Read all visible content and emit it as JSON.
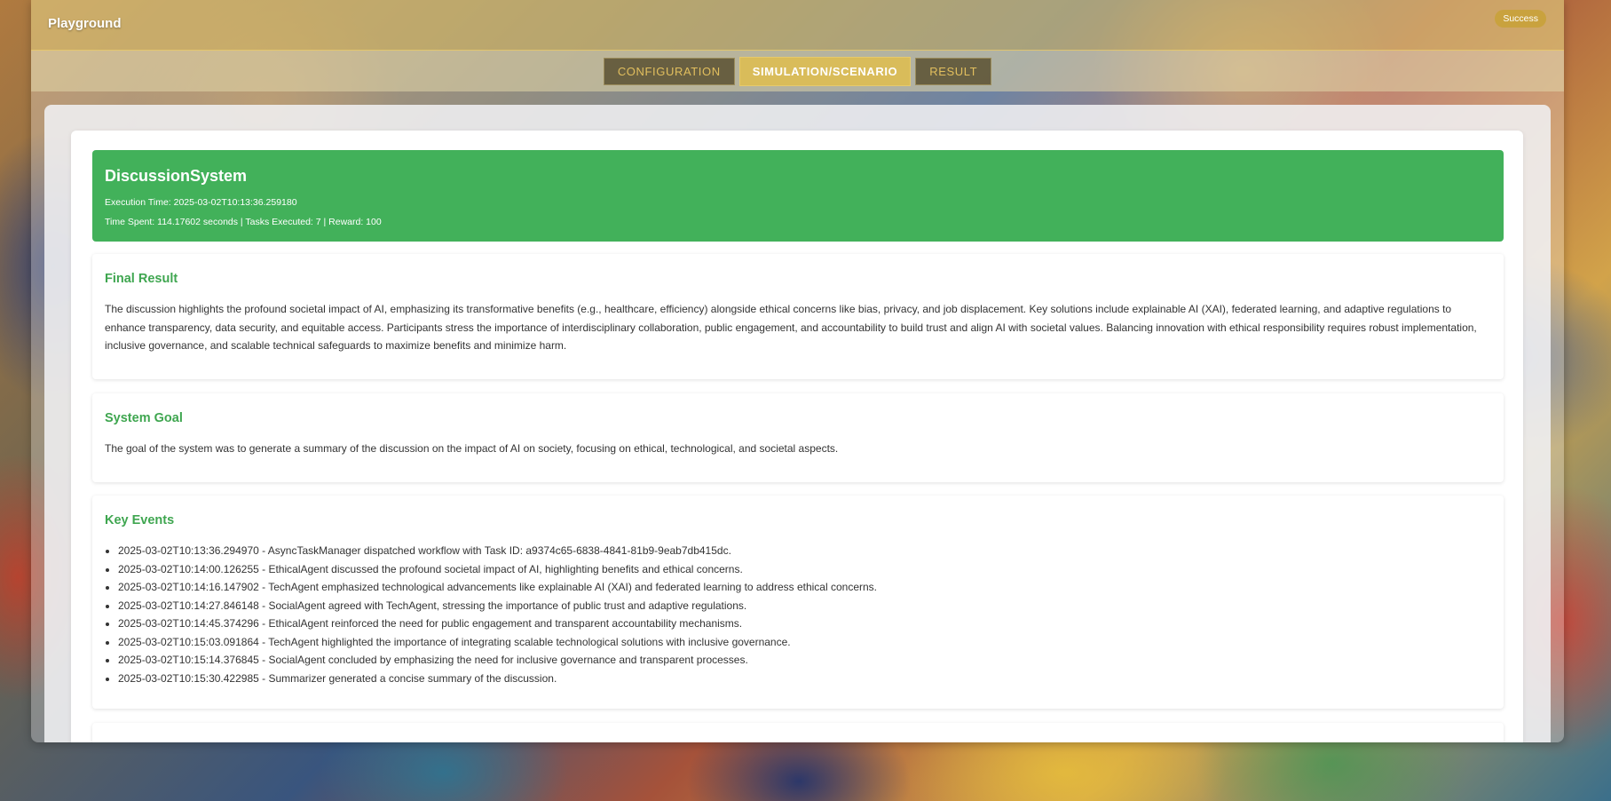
{
  "header": {
    "title": "Playground",
    "status": "Success"
  },
  "tabs": [
    {
      "label": "CONFIGURATION",
      "active": false
    },
    {
      "label": "SIMULATION/SCENARIO",
      "active": true
    },
    {
      "label": "RESULT",
      "active": false
    }
  ],
  "summary": {
    "system_name": "DiscussionSystem",
    "execution_time": "Execution Time: 2025-03-02T10:13:36.259180",
    "stats": "Time Spent: 114.17602 seconds | Tasks Executed: 7 | Reward: 100"
  },
  "final_result": {
    "heading": "Final Result",
    "text": "The discussion highlights the profound societal impact of AI, emphasizing its transformative benefits (e.g., healthcare, efficiency) alongside ethical concerns like bias, privacy, and job displacement. Key solutions include explainable AI (XAI), federated learning, and adaptive regulations to enhance transparency, data security, and equitable access. Participants stress the importance of interdisciplinary collaboration, public engagement, and accountability to build trust and align AI with societal values. Balancing innovation with ethical responsibility requires robust implementation, inclusive governance, and scalable technical safeguards to maximize benefits and minimize harm."
  },
  "system_goal": {
    "heading": "System Goal",
    "text": "The goal of the system was to generate a summary of the discussion on the impact of AI on society, focusing on ethical, technological, and societal aspects."
  },
  "key_events": {
    "heading": "Key Events",
    "items": [
      "2025-03-02T10:13:36.294970 - AsyncTaskManager dispatched workflow with Task ID: a9374c65-6838-4841-81b9-9eab7db415dc.",
      "2025-03-02T10:14:00.126255 - EthicalAgent discussed the profound societal impact of AI, highlighting benefits and ethical concerns.",
      "2025-03-02T10:14:16.147902 - TechAgent emphasized technological advancements like explainable AI (XAI) and federated learning to address ethical concerns.",
      "2025-03-02T10:14:27.846148 - SocialAgent agreed with TechAgent, stressing the importance of public trust and adaptive regulations.",
      "2025-03-02T10:14:45.374296 - EthicalAgent reinforced the need for public engagement and transparent accountability mechanisms.",
      "2025-03-02T10:15:03.091864 - TechAgent highlighted the importance of integrating scalable technological solutions with inclusive governance.",
      "2025-03-02T10:15:14.376845 - SocialAgent concluded by emphasizing the need for inclusive governance and transparent processes.",
      "2025-03-02T10:15:30.422985 - Summarizer generated a concise summary of the discussion."
    ]
  }
}
